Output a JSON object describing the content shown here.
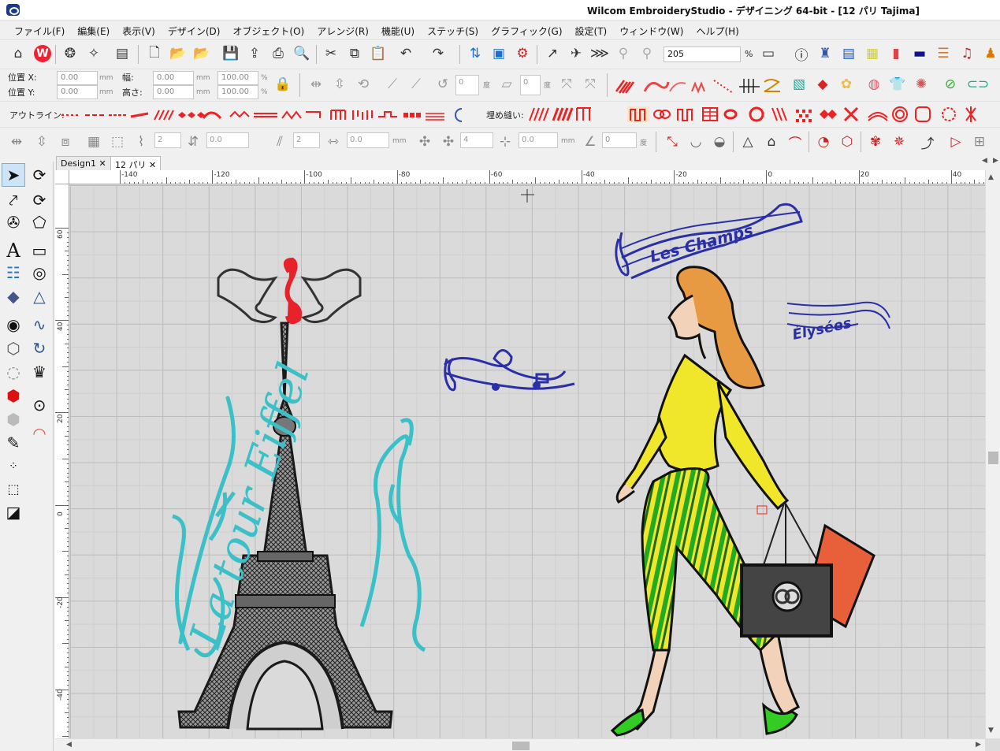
{
  "window": {
    "title": "Wilcom EmbroideryStudio - デザイニング 64-bit - [12 パリ          Tajima]"
  },
  "menu": [
    "ファイル(F)",
    "編集(E)",
    "表示(V)",
    "デザイン(D)",
    "オブジェクト(O)",
    "アレンジ(R)",
    "機能(U)",
    "ステッチ(S)",
    "グラフィック(G)",
    "設定(T)",
    "ウィンドウ(W)",
    "ヘルプ(H)"
  ],
  "toolbar": {
    "zoom_value": "205",
    "zoom_unit": "%"
  },
  "props": {
    "pos_x_label": "位置 X:",
    "pos_y_label": "位置 Y:",
    "width_label": "幅:",
    "height_label": "高さ:",
    "pos_x": "0.00",
    "pos_y": "0.00",
    "width": "0.00",
    "height": "0.00",
    "scale_w": "100.00",
    "scale_h": "100.00",
    "mm": "mm",
    "pct": "%",
    "angle1": "0",
    "angle2": "0",
    "deg": "度"
  },
  "outline": {
    "label": "アウトライン:",
    "fill_label": "埋め縫い:"
  },
  "spacing": {
    "v1": "2",
    "v2": "0.0",
    "v3": "2",
    "v4": "0.0",
    "v5": "4",
    "v6": "0.0",
    "v7": "0",
    "mm": "mm",
    "deg": "度"
  },
  "tabs": [
    {
      "label": "Design1"
    },
    {
      "label": "12 パリ"
    }
  ],
  "ruler": {
    "h_labels": [
      "-140",
      "-120",
      "-100",
      "-80",
      "-60",
      "-40",
      "-20",
      "0",
      "20",
      "40"
    ],
    "v_labels": [
      "60",
      "40",
      "20",
      "0",
      "-20",
      "-40"
    ]
  },
  "design": {
    "tower_text": "La tour Eiffel",
    "champs_text": "Les Champs",
    "elysees_text": "Élysées"
  },
  "colors": {
    "teal": "#3cc0c8",
    "blue": "#2a2fa8",
    "red": "#e11",
    "yellow": "#f0e62a",
    "green": "#33cc22"
  }
}
